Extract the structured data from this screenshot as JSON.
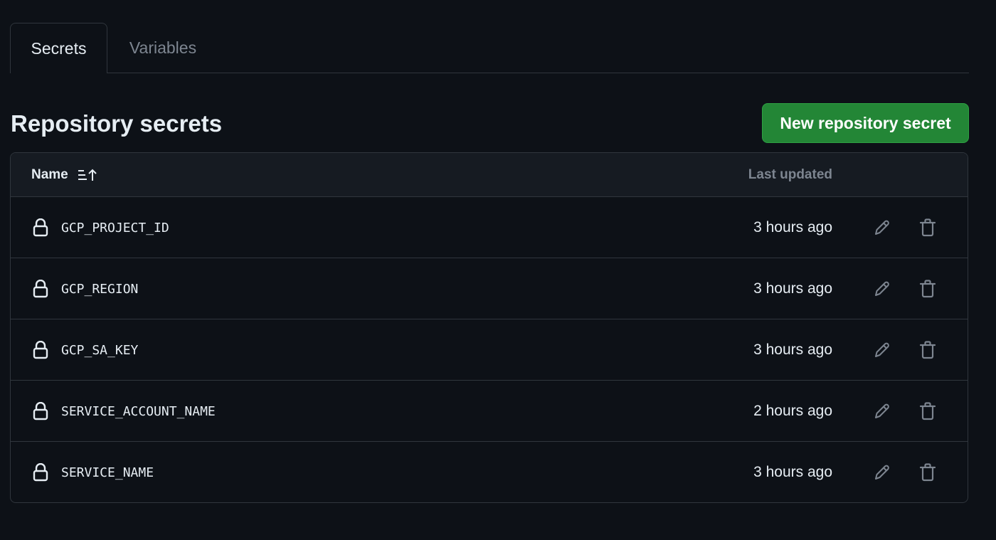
{
  "tabs": [
    {
      "label": "Secrets",
      "active": true
    },
    {
      "label": "Variables",
      "active": false
    }
  ],
  "page_title": "Repository secrets",
  "new_button_label": "New repository secret",
  "table": {
    "columns": {
      "name": "Name",
      "updated": "Last updated"
    },
    "sort_icon": "sort-ascending-icon",
    "rows": [
      {
        "name": "GCP_PROJECT_ID",
        "updated": "3 hours ago"
      },
      {
        "name": "GCP_REGION",
        "updated": "3 hours ago"
      },
      {
        "name": "GCP_SA_KEY",
        "updated": "3 hours ago"
      },
      {
        "name": "SERVICE_ACCOUNT_NAME",
        "updated": "2 hours ago"
      },
      {
        "name": "SERVICE_NAME",
        "updated": "3 hours ago"
      }
    ],
    "row_icon": "lock-icon",
    "action_icons": [
      "pencil-icon",
      "trash-icon"
    ]
  },
  "colors": {
    "background": "#0d1117",
    "border": "#30363d",
    "header_bg": "#161b22",
    "text": "#e6edf3",
    "muted": "#7d8590",
    "primary_button": "#238636"
  }
}
